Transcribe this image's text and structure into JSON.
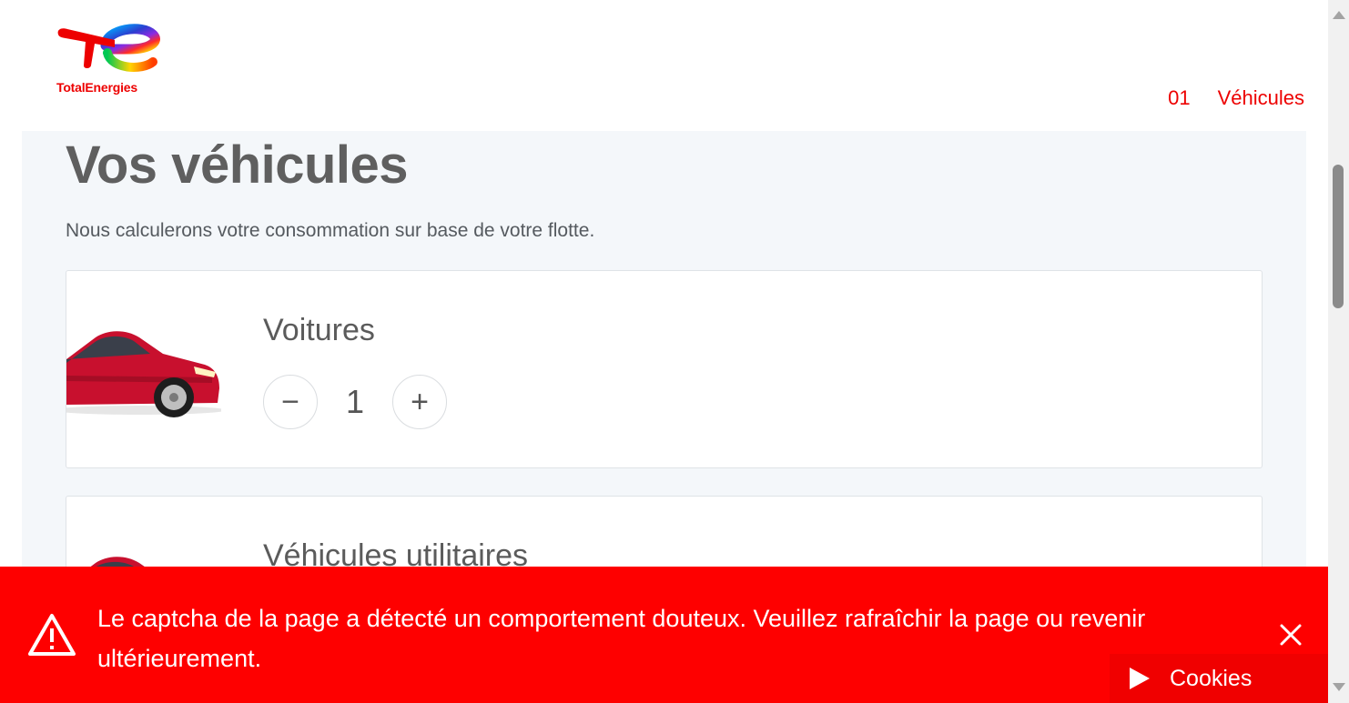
{
  "brand": {
    "name": "TotalEnergies"
  },
  "stepnav": {
    "number": "01",
    "label": "Véhicules"
  },
  "page": {
    "title": "Vos véhicules",
    "subtitle": "Nous calculerons votre consommation sur base de votre flotte."
  },
  "vehicles": [
    {
      "label": "Voitures",
      "count": "1",
      "decrement": "−",
      "increment": "+"
    },
    {
      "label": "Véhicules utilitaires"
    }
  ],
  "alert": {
    "message": "Le captcha de la page a détecté un comportement douteux. Veuillez rafraîchir la page ou revenir ultérieurement.",
    "icon": "warning-icon",
    "close_icon": "close-icon"
  },
  "cookies": {
    "label": "Cookies",
    "icon": "play-icon"
  },
  "colors": {
    "brand_red": "#ed0000",
    "alert_red": "#fe0000",
    "background": "#f4f7fa"
  }
}
